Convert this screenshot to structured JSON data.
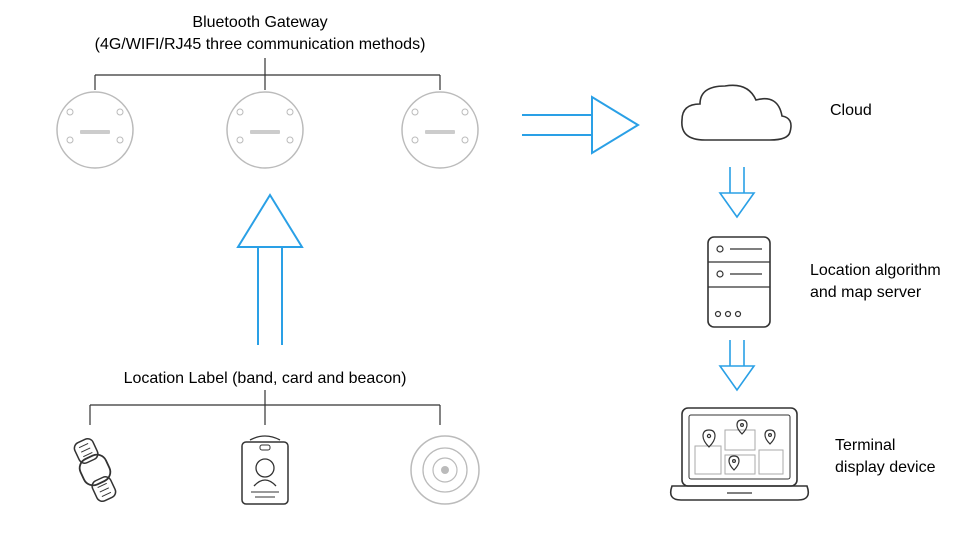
{
  "labels": {
    "gateway_title": "Bluetooth Gateway",
    "gateway_subtitle": "(4G/WIFI/RJ45 three communication methods)",
    "location_label_title": "Location Label (band, card and beacon)",
    "cloud": "Cloud",
    "server": "Location algorithm\nand map server",
    "terminal": "Terminal\ndisplay device"
  },
  "colors": {
    "accent": "#2aa0e6",
    "line": "#333333"
  }
}
